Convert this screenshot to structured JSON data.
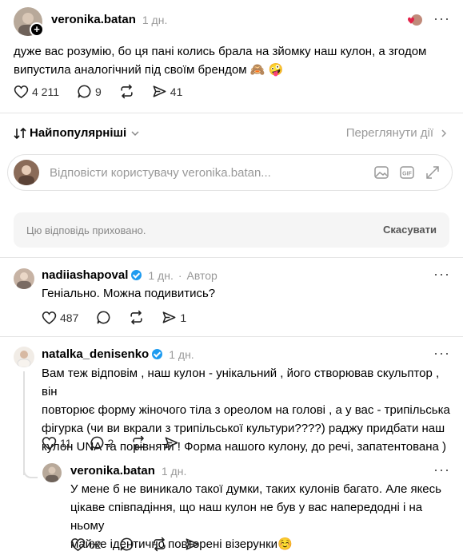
{
  "post": {
    "username": "veronika.batan",
    "time": "1 дн.",
    "text_line1": "дуже вас розумію, бо ця пані колись брала на зйомку наш кулон, а згодом",
    "text_line2": "випустила аналогічний під своїм брендом 🙈 🤪",
    "likes": "4 211",
    "comments": "9",
    "shares": "41"
  },
  "sort": {
    "label": "Найпопулярніші",
    "view_activity": "Переглянути дії"
  },
  "reply_box": {
    "placeholder": "Відповісти користувачу veronika.batan..."
  },
  "hidden_reply": {
    "text": "Цю відповідь приховано.",
    "cancel": "Скасувати"
  },
  "comments": [
    {
      "username": "nadiiashapoval",
      "time": "1 дн.",
      "author_label": "Автор",
      "text": "Геніально. Можна подивитись?",
      "likes": "487",
      "shares": "1"
    },
    {
      "username": "natalka_denisenko",
      "time": "1 дн.",
      "lines": [
        "Вам теж відповім , наш кулон - унікальний , його створював скульптор , він",
        "повторює форму жіночого тіла з ореолом на голові , а у вас - трипільська",
        "фігурка (чи ви вкрали з трипільської культури????) раджу придбати наш",
        "кулон UNA та порівняти ! Форма нашого кулону, до речі, запатентована )"
      ],
      "likes": "11",
      "comments": "2"
    },
    {
      "username": "veronika.batan",
      "time": "1 дн.",
      "lines": [
        "У мене б не виникало такої думки, таких кулонів багато. Але якесь",
        "цікаве співпадіння, що наш кулон не був у вас напередодні і на ньому",
        "майже ідентично повторені візерунки☺️"
      ],
      "likes": "62"
    }
  ],
  "icons": {
    "more": "more-dots-icon",
    "heart": "heart-icon",
    "comment": "comment-icon",
    "repost": "repost-icon",
    "share": "share-icon",
    "verified": "verified-badge-icon"
  },
  "colors": {
    "verified": "#1d9bf0",
    "muted": "#999999"
  }
}
